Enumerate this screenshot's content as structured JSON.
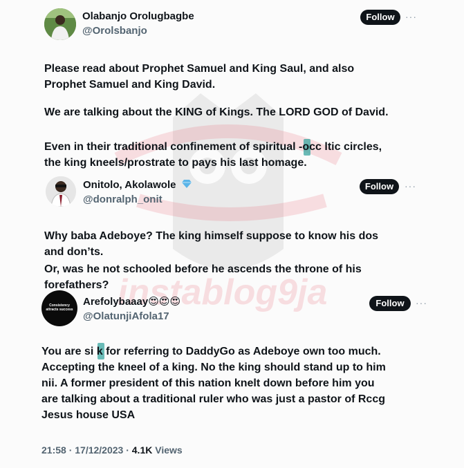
{
  "post1": {
    "name": "Olabanjo Orolugbagbe",
    "handle": "@Orolsbanjo",
    "follow_label": "Follow",
    "more": "···",
    "p1": "Please read about Prophet Samuel and King Saul, and also\nProphet Samuel and King David.",
    "p2": "We are talking about the KING of Kings. The LORD GOD of David.",
    "p3": "Even in their traditional confinement of spiritual -occ   ltic circles,\nthe king kneels/prostrate to pays his last homage."
  },
  "post2": {
    "name": "Onitolo, Akolawole",
    "verified_icon": "blue-diamond-badge",
    "handle": "@donralph_onit",
    "follow_label": "Follow",
    "more": "···",
    "p1": "Why baba Adeboye? The king himself suppose to know his dos\nand don’ts.",
    "p2": "Or, was he not schooled before he ascends the throne of his\nforefathers?"
  },
  "post3": {
    "name": "Arefolybaaay",
    "name_emojis": "😍😍😍",
    "handle": "@OlatunjiAfola17",
    "avatar_text": "Consistency attracts success",
    "follow_label": "Follow",
    "more": "···",
    "p1": "You are si  k for referring to DaddyGo as Adeboye own too much.\nAccepting the kneel of a king. No the king should stand up to him\nnii. A former president of this nation knelt down before him you\nare talking about a traditional ruler who was just a pastor of Rccg\nJesus house USA",
    "timestamp": "21:58 · 17/12/2023 · ",
    "views_count": "4.1K",
    "views_label": " Views"
  },
  "watermark": {
    "text": "instablog9ja"
  },
  "colors": {
    "follow_bg": "#0f1419",
    "text": "#0f1419",
    "muted": "#536471",
    "accent_shade": "#3aa6a0"
  }
}
